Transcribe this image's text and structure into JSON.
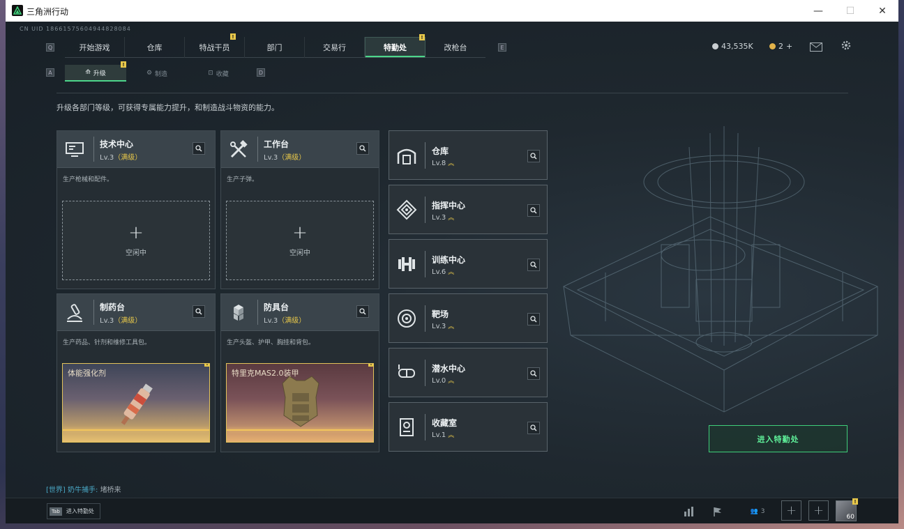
{
  "window": {
    "title": "三角洲行动",
    "minimize": "—",
    "maximize": "☐",
    "close": "✕"
  },
  "uid": "CN UID 18661575604944828084",
  "nav": {
    "key_left": "Q",
    "key_right": "E",
    "tabs": [
      {
        "label": "开始游戏",
        "badge": ""
      },
      {
        "label": "仓库",
        "badge": ""
      },
      {
        "label": "特战干员",
        "badge": "!"
      },
      {
        "label": "部门",
        "badge": ""
      },
      {
        "label": "交易行",
        "badge": ""
      },
      {
        "label": "特勤处",
        "badge": "!"
      },
      {
        "label": "改枪台",
        "badge": ""
      }
    ]
  },
  "subnav": {
    "key_left": "A",
    "key_right": "D",
    "tabs": [
      {
        "label": "升级",
        "badge": "!"
      },
      {
        "label": "制造",
        "badge": ""
      },
      {
        "label": "收藏",
        "badge": ""
      }
    ]
  },
  "currency": {
    "silver": "43,535K",
    "gold": "2",
    "plus": "+"
  },
  "description": "升级各部门等级，可获得专属能力提升，和制造战斗物资的能力。",
  "workshops": [
    {
      "name": "技术中心",
      "level": "Lv.3",
      "max": "（满级）",
      "desc": "生产枪械和配件。",
      "status": "空闲中",
      "icon": "tech-center-icon"
    },
    {
      "name": "工作台",
      "level": "Lv.3",
      "max": "（满级）",
      "desc": "生产子弹。",
      "status": "空闲中",
      "icon": "workbench-icon"
    },
    {
      "name": "制药台",
      "level": "Lv.3",
      "max": "（满级）",
      "desc": "生产药品、针剂和维修工具包。",
      "product": "体能强化剂",
      "product_badge": "!",
      "icon": "pharmacy-icon"
    },
    {
      "name": "防具台",
      "level": "Lv.3",
      "max": "（满级）",
      "desc": "生产头盔、护甲、胸挂和背包。",
      "product": "特里克MAS2.0装甲",
      "product_badge": "!",
      "icon": "armory-icon"
    }
  ],
  "facilities": [
    {
      "name": "仓库",
      "level": "Lv.8",
      "upgrade": "︽",
      "icon": "warehouse-icon"
    },
    {
      "name": "指挥中心",
      "level": "Lv.3",
      "upgrade": "︽",
      "icon": "command-center-icon"
    },
    {
      "name": "训练中心",
      "level": "Lv.6",
      "upgrade": "︽",
      "icon": "training-center-icon"
    },
    {
      "name": "靶场",
      "level": "Lv.3",
      "upgrade": "︽",
      "icon": "shooting-range-icon"
    },
    {
      "name": "潜水中心",
      "level": "Lv.0",
      "upgrade": "︽",
      "icon": "diving-center-icon"
    },
    {
      "name": "收藏室",
      "level": "Lv.1",
      "upgrade": "︽",
      "icon": "collection-room-icon"
    }
  ],
  "enter_button": "进入特勤处",
  "chat": {
    "channel": "[世界]",
    "user": "奶牛捕手:",
    "message": "堵桥来"
  },
  "bottom": {
    "tab_key": "Tab",
    "tab_label": "进入特勤处",
    "squad_count": "3",
    "level": "60",
    "badge": "!"
  },
  "colors": {
    "accent": "#4dd68b",
    "max_level": "#e8c84a",
    "background": "#1f282f"
  }
}
